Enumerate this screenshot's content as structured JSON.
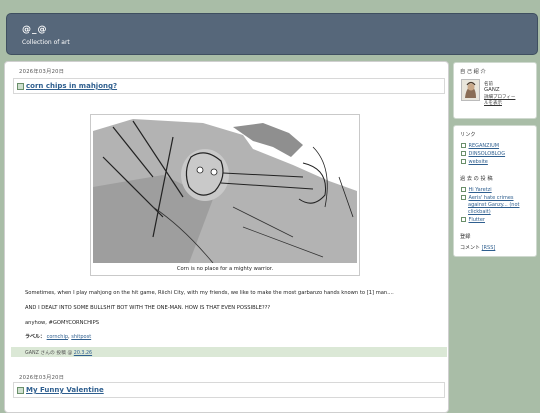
{
  "header": {
    "title": "@_@",
    "description": "Collection of art"
  },
  "posts": [
    {
      "date": "2026年03月20日",
      "title": "corn chips in mahjong?",
      "caption": "Corn is no place for a mighty warrior.",
      "paragraphs": [
        "Sometimes, when I play mahjong on the hit game, Riichi City, with my friends, we like to make the most garbanzo hands known to [1] man....",
        "AND I DEALT INTO SOME BULLSHIT BOT WITH THE ONE-MAN. HOW IS THAT EVEN POSSIBLE???",
        "anyhow, #GOMYCORNCHIPS"
      ],
      "labels_label": "ラベル：",
      "labels": [
        "cornchip",
        "shitpost"
      ],
      "footer": {
        "author": "GANZ さんの 投稿",
        "at": "@",
        "time": "20.3.26"
      }
    },
    {
      "date": "2026年03月20日",
      "title": "My Funny Valentine"
    }
  ],
  "sidebar": {
    "profile": {
      "title": "自 己 紹 介",
      "name_label": "名前",
      "name": "GANZ",
      "link_lines": [
        "詳細プロフィー",
        "ルを表示"
      ]
    },
    "links": {
      "title": "リンク",
      "items": [
        "REGANZIUM",
        "DINSOLOBLOG",
        "website"
      ]
    },
    "recent": {
      "title": "過 去 の 投 稿",
      "items": [
        {
          "lines": [
            "Hi Yaretzi"
          ]
        },
        {
          "lines": [
            "Aeris' hate crimes",
            "against Ganzy... (not",
            "clickbait)"
          ]
        },
        {
          "lines": [
            "Flutter"
          ]
        }
      ]
    },
    "subscribe": {
      "title": "登録",
      "comment_label": "コメント",
      "rss": "[RSS]"
    }
  }
}
